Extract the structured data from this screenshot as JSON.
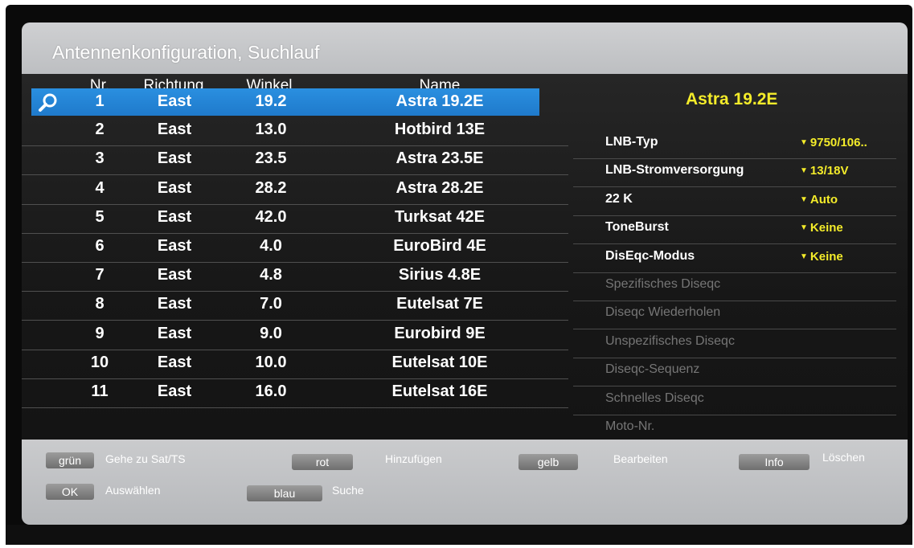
{
  "window": {
    "title": "Antennenkonfiguration, Suchlauf"
  },
  "table": {
    "headers": {
      "nr": "Nr.",
      "richtung": "Richtung",
      "winkel": "Winkel",
      "name": "Name"
    },
    "rows": [
      {
        "nr": "1",
        "richtung": "East",
        "winkel": "19.2",
        "name": "Astra 19.2E",
        "selected": true
      },
      {
        "nr": "2",
        "richtung": "East",
        "winkel": "13.0",
        "name": "Hotbird 13E"
      },
      {
        "nr": "3",
        "richtung": "East",
        "winkel": "23.5",
        "name": "Astra 23.5E"
      },
      {
        "nr": "4",
        "richtung": "East",
        "winkel": "28.2",
        "name": "Astra 28.2E"
      },
      {
        "nr": "5",
        "richtung": "East",
        "winkel": "42.0",
        "name": "Turksat 42E"
      },
      {
        "nr": "6",
        "richtung": "East",
        "winkel": "4.0",
        "name": "EuroBird 4E"
      },
      {
        "nr": "7",
        "richtung": "East",
        "winkel": "4.8",
        "name": "Sirius 4.8E"
      },
      {
        "nr": "8",
        "richtung": "East",
        "winkel": "7.0",
        "name": "Eutelsat 7E"
      },
      {
        "nr": "9",
        "richtung": "East",
        "winkel": "9.0",
        "name": "Eurobird 9E"
      },
      {
        "nr": "10",
        "richtung": "East",
        "winkel": "10.0",
        "name": "Eutelsat 10E"
      },
      {
        "nr": "11",
        "richtung": "East",
        "winkel": "16.0",
        "name": "Eutelsat 16E"
      }
    ],
    "selected_icon": "search-icon"
  },
  "settings": {
    "satellite": "Astra 19.2E",
    "options": [
      {
        "label": "LNB-Typ",
        "value": "9750/106..",
        "enabled": true
      },
      {
        "label": "LNB-Stromversorgung",
        "value": "13/18V",
        "enabled": true
      },
      {
        "label": "22 K",
        "value": "Auto",
        "enabled": true
      },
      {
        "label": "ToneBurst",
        "value": "Keine",
        "enabled": true
      },
      {
        "label": "DisEqc-Modus",
        "value": "Keine",
        "enabled": true
      },
      {
        "label": "Spezifisches Diseqc",
        "value": "",
        "enabled": false
      },
      {
        "label": "Diseqc Wiederholen",
        "value": "",
        "enabled": false
      },
      {
        "label": "Unspezifisches Diseqc",
        "value": "",
        "enabled": false
      },
      {
        "label": "Diseqc-Sequenz",
        "value": "",
        "enabled": false
      },
      {
        "label": "Schnelles Diseqc",
        "value": "",
        "enabled": false
      },
      {
        "label": "Moto-Nr.",
        "value": "",
        "enabled": false
      }
    ],
    "dropdown_icon": "triangle-down-icon"
  },
  "footer": {
    "keys": [
      {
        "key": "grün",
        "label": "Gehe zu Sat/TS"
      },
      {
        "key": "rot",
        "label": "Hinzufügen"
      },
      {
        "key": "gelb",
        "label": "Bearbeiten"
      },
      {
        "key": "Info",
        "label": "Löschen"
      },
      {
        "key": "OK",
        "label": "Auswählen"
      },
      {
        "key": "blau",
        "label": "Suche"
      }
    ]
  },
  "colors": {
    "accent_selection": "#2188dd",
    "value_yellow": "#f4ec2a",
    "panel_dark": "#1c1c1c",
    "frame_grey": "#c4c5c7"
  }
}
